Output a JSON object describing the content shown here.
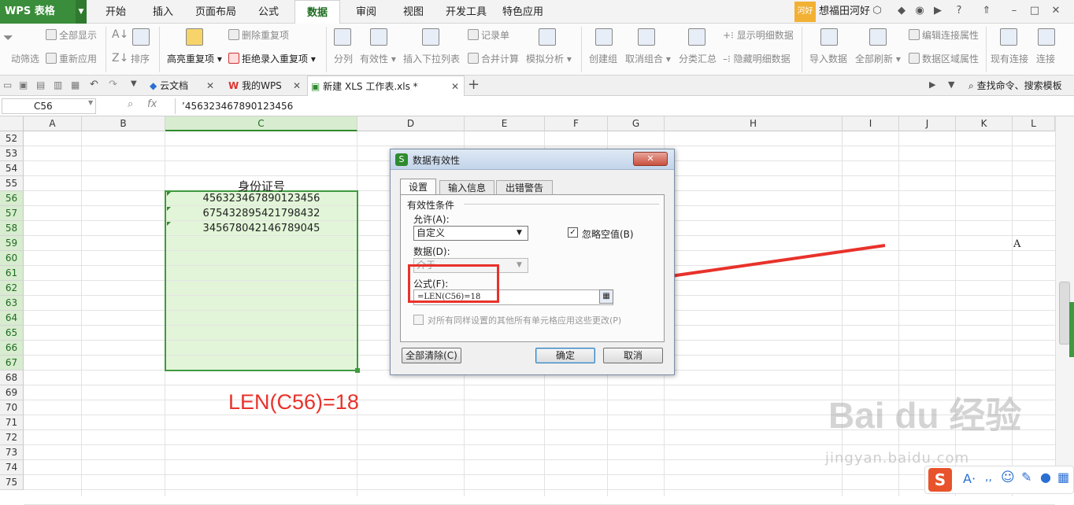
{
  "app": {
    "logo": "WPS 表格",
    "menus": [
      "开始",
      "插入",
      "页面布局",
      "公式",
      "数据",
      "审阅",
      "视图",
      "开发工具",
      "特色应用"
    ],
    "active_menu": "数据",
    "user_badge": "河好",
    "user_name": "想福田河好"
  },
  "ribbon": {
    "auto_filter": "动筛选",
    "show_all": "全部显示",
    "reapply": "重新应用",
    "sort": "排序",
    "highlight_dup": "高亮重复项",
    "delete_dup": "删除重复项",
    "reject_dup": "拒绝录入重复项",
    "split": "分列",
    "validity": "有效性",
    "insert_dropdown": "插入下拉列表",
    "record": "记录单",
    "merge_calc": "合并计算",
    "simulate": "模拟分析",
    "create_group": "创建组",
    "ungroup": "取消组合",
    "subtotal": "分类汇总",
    "show_detail": "显示明细数据",
    "hide_detail": "隐藏明细数据",
    "import_data": "导入数据",
    "refresh_all": "全部刷新",
    "edit_link": "编辑连接属性",
    "data_range": "数据区域属性",
    "existing_conn": "现有连接",
    "connect": "连接"
  },
  "tabs": {
    "cloud": "云文档",
    "mywps": "我的WPS",
    "file": "新建 XLS 工作表.xls *",
    "search": "查找命令、搜索模板"
  },
  "formula_bar": {
    "name_box": "C56",
    "fx": "fx",
    "content": "’456323467890123456"
  },
  "sheet": {
    "columns": [
      "A",
      "B",
      "C",
      "D",
      "E",
      "F",
      "G",
      "H",
      "I",
      "J",
      "K",
      "L"
    ],
    "rows": [
      "52",
      "53",
      "54",
      "55",
      "56",
      "57",
      "58",
      "59",
      "60",
      "61",
      "62",
      "63",
      "64",
      "65",
      "66",
      "67",
      "68",
      "69",
      "70",
      "71",
      "72",
      "73",
      "74",
      "75"
    ],
    "header_label": "身份证号",
    "ids": [
      "456323467890123456",
      "675432895421798432",
      "345678042146789045"
    ],
    "l59_value": "A",
    "annotation": "LEN(C56)=18"
  },
  "dialog": {
    "title": "数据有效性",
    "tabs": [
      "设置",
      "输入信息",
      "出错警告"
    ],
    "section": "有效性条件",
    "allow_label": "允许(A):",
    "allow_value": "自定义",
    "ignore_blank": "忽略空值(B)",
    "data_label": "数据(D):",
    "data_value": "介于",
    "formula_label": "公式(F):",
    "formula_value": "=LEN(C56)=18",
    "apply_all": "对所有同样设置的其他所有单元格应用这些更改(P)",
    "clear_all": "全部清除(C)",
    "ok": "确定",
    "cancel": "取消"
  },
  "watermark": {
    "brand": "Bai du 经验",
    "url": "jingyan.baidu.com"
  },
  "colors": {
    "accent_green": "#2e8b2e",
    "selection_fill": "#e2f5d8",
    "annotation_red": "#e8322b"
  }
}
